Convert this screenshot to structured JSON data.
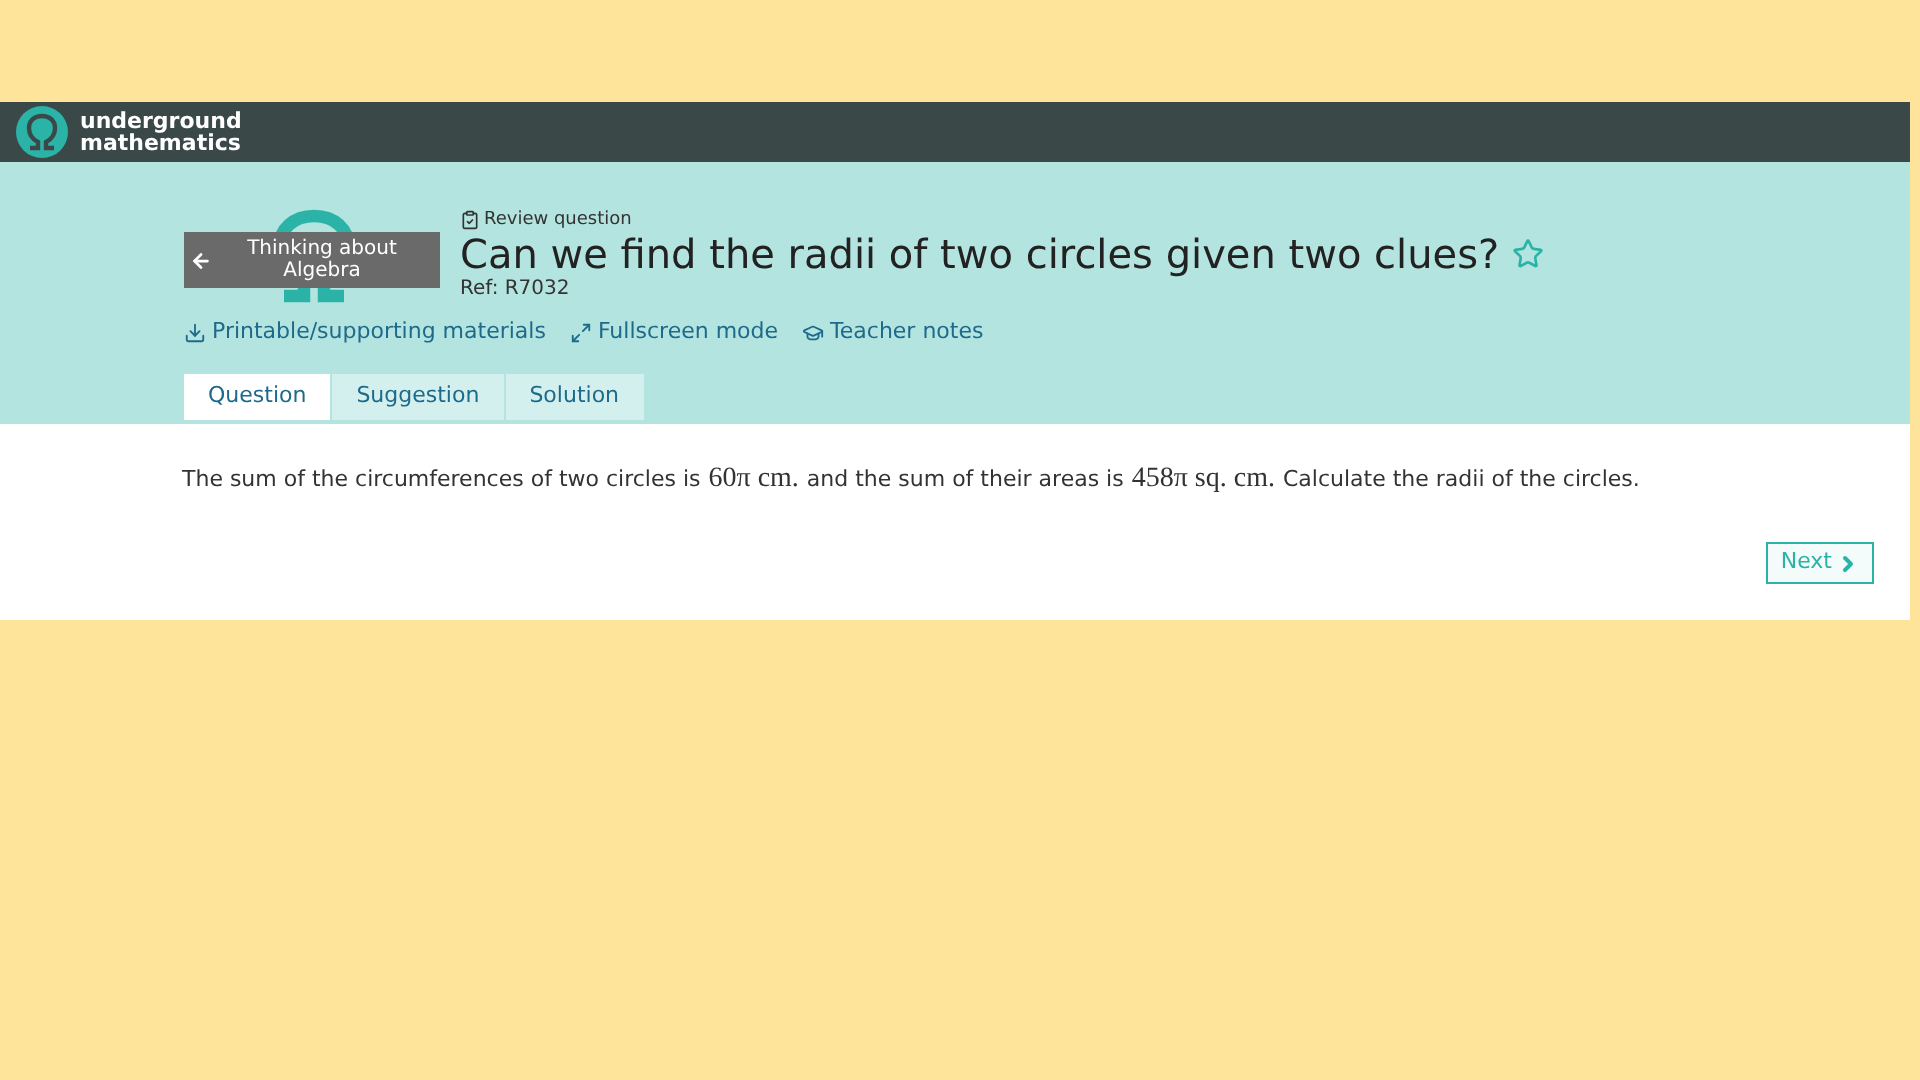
{
  "header": {
    "logo_line_1": "underground",
    "logo_line_2": "mathematics"
  },
  "back_link": {
    "label_line_1": "Thinking about",
    "label_line_2": "Algebra"
  },
  "resource": {
    "type_label": "Review question",
    "title": "Can we find the radii of two circles given two clues?",
    "starred": false,
    "ref": "Ref: R7032"
  },
  "links": [
    {
      "kind": "download",
      "label": "Printable/supporting materials"
    },
    {
      "kind": "fullscreen",
      "label": "Fullscreen mode"
    },
    {
      "kind": "teacher",
      "label": "Teacher notes"
    }
  ],
  "tabs": [
    {
      "label": "Question",
      "selected": true
    },
    {
      "label": "Suggestion",
      "selected": false
    },
    {
      "label": "Solution",
      "selected": false
    }
  ],
  "question": [
    {
      "kind": "text",
      "text": "The sum of the circumferences of two circles is"
    },
    {
      "kind": "math",
      "text": "60π cm."
    },
    {
      "kind": "text",
      "text": "and the sum of their areas is"
    },
    {
      "kind": "math",
      "text": "458π sq. cm."
    },
    {
      "kind": "text",
      "text": "Calculate the radii of the circles."
    }
  ],
  "next_button": {
    "label": "Next"
  }
}
